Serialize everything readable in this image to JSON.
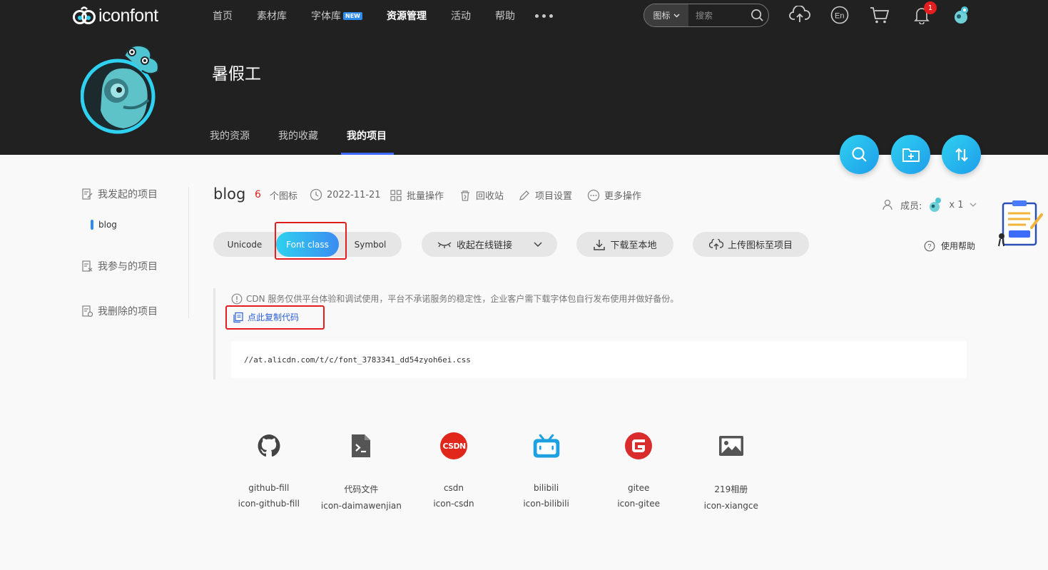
{
  "brand": {
    "name": "iconfont"
  },
  "nav": {
    "items": [
      {
        "label": "首页"
      },
      {
        "label": "素材库"
      },
      {
        "label": "字体库",
        "badge": "NEW"
      },
      {
        "label": "资源管理",
        "active": true
      },
      {
        "label": "活动"
      },
      {
        "label": "帮助"
      }
    ]
  },
  "search": {
    "type": "图标",
    "placeholder": "搜索"
  },
  "notifications": {
    "count": "1"
  },
  "profile": {
    "name": "暑假工"
  },
  "subtabs": [
    {
      "label": "我的资源"
    },
    {
      "label": "我的收藏"
    },
    {
      "label": "我的项目",
      "active": true
    }
  ],
  "sidebar": {
    "created": "我发起的项目",
    "project": "blog",
    "joined": "我参与的项目",
    "deleted": "我删除的项目"
  },
  "project": {
    "title": "blog",
    "count": "6",
    "count_unit": "个图标",
    "date": "2022-11-21",
    "batch": "批量操作",
    "recycle": "回收站",
    "settings": "项目设置",
    "more": "更多操作",
    "members_label": "成员:",
    "members_count": "x 1"
  },
  "modes": {
    "unicode": "Unicode",
    "fontclass": "Font class",
    "symbol": "Symbol"
  },
  "actions": {
    "collapse": "收起在线链接",
    "download": "下载至本地",
    "upload": "上传图标至项目",
    "help": "使用帮助"
  },
  "notice": {
    "text": "CDN 服务仅供平台体验和调试使用，平台不承诺服务的稳定性，企业客户需下载字体包自行发布使用并做好备份。",
    "copy": "点此复制代码",
    "code": "//at.alicdn.com/t/c/font_3783341_dd54zyoh6ei.css"
  },
  "icons": [
    {
      "name": "github-fill",
      "class": "icon-github-fill",
      "glyph": "github-icon",
      "color": "#444444"
    },
    {
      "name": "代码文件",
      "class": "icon-daimawenjian",
      "glyph": "code-file-icon",
      "color": "#555555"
    },
    {
      "name": "csdn",
      "class": "icon-csdn",
      "glyph": "csdn-icon",
      "color": "#e1261c"
    },
    {
      "name": "bilibili",
      "class": "icon-bilibili",
      "glyph": "bilibili-icon",
      "color": "#1ea0e3"
    },
    {
      "name": "gitee",
      "class": "icon-gitee",
      "glyph": "gitee-icon",
      "color": "#d92c2c"
    },
    {
      "name": "219相册",
      "class": "icon-xiangce",
      "glyph": "photo-album-icon",
      "color": "#555555"
    }
  ],
  "colors": {
    "header_bg": "#212121",
    "accent": "#2d8cf0",
    "highlight": "#e31e1e"
  }
}
